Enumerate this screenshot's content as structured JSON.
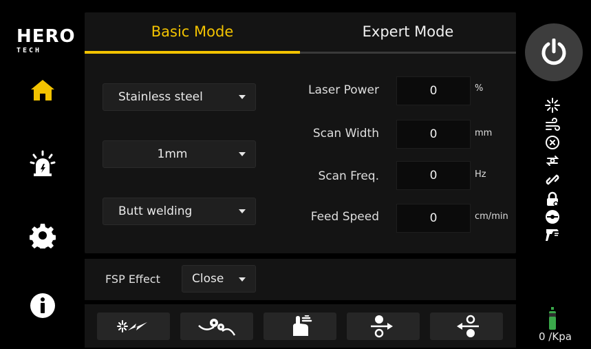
{
  "brand": {
    "line1": "HERO",
    "line2": "TECH"
  },
  "tabs": [
    {
      "label": "Basic Mode",
      "active": true
    },
    {
      "label": "Expert Mode",
      "active": false
    }
  ],
  "material": {
    "selected": "Stainless steel"
  },
  "thickness": {
    "selected": "1mm"
  },
  "weld_type": {
    "selected": "Butt welding"
  },
  "params": [
    {
      "label": "Laser Power",
      "value": "0",
      "unit": "%"
    },
    {
      "label": "Scan Width",
      "value": "0",
      "unit": "mm"
    },
    {
      "label": "Scan Freq.",
      "value": "0",
      "unit": "Hz"
    },
    {
      "label": "Feed Speed",
      "value": "0",
      "unit": "cm/min"
    }
  ],
  "fsp": {
    "label": "FSP Effect",
    "selected": "Close"
  },
  "gauge": {
    "reading": "0 /Kpa"
  },
  "colors": {
    "accent": "#f3c300",
    "gauge": "#3aa84a"
  },
  "icons": {
    "nav": [
      "home-icon",
      "alarm-icon",
      "settings-icon",
      "info-icon"
    ],
    "bottom": [
      "laser-icon",
      "wire-feed-icon",
      "gas-icon",
      "feed-forward-icon",
      "feed-back-icon"
    ],
    "status": [
      "laser-status-icon",
      "air-flow-icon",
      "water-icon",
      "cooling-icon",
      "link-icon",
      "lock-icon",
      "sensor-icon",
      "torch-icon"
    ]
  }
}
